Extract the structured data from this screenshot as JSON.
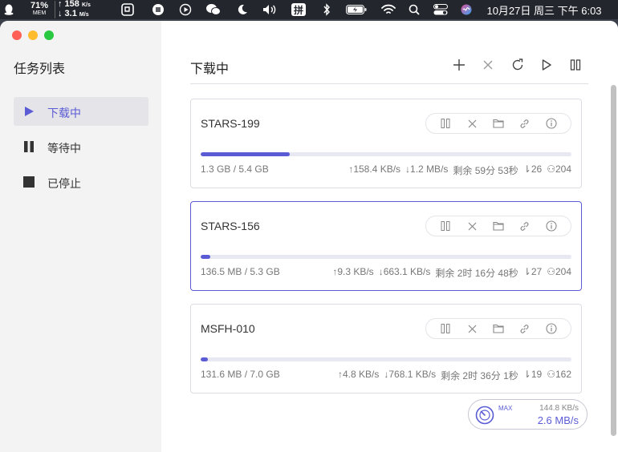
{
  "menubar": {
    "cpu_percent": "71%",
    "mem_label": "MEM",
    "net_up": "↑ 158",
    "net_up_unit": "K/s",
    "net_down": "↓ 3.1",
    "net_down_unit": "M/s",
    "input_method": "拼",
    "datetime": "10月27日 周三 下午 6:03"
  },
  "sidebar": {
    "title": "任务列表",
    "items": [
      {
        "label": "下载中",
        "icon": "play-icon"
      },
      {
        "label": "等待中",
        "icon": "pause-icon"
      },
      {
        "label": "已停止",
        "icon": "stop-icon"
      }
    ]
  },
  "main": {
    "title": "下载中",
    "toolbar_icons": [
      "plus-icon",
      "close-icon",
      "refresh-icon",
      "play-icon",
      "pause-icon"
    ]
  },
  "tasks": [
    {
      "name": "STARS-199",
      "progress": 0.24,
      "size": "1.3 GB / 5.4 GB",
      "upload": "158.4 KB/s",
      "download": "1.2 MB/s",
      "remaining": "剩余 59分 53秒",
      "connections": "26",
      "peers": "204"
    },
    {
      "name": "STARS-156",
      "progress": 0.026,
      "size": "136.5 MB / 5.3 GB",
      "upload": "9.3 KB/s",
      "download": "663.1 KB/s",
      "remaining": "剩余 2时 16分 48秒",
      "connections": "27",
      "peers": "204"
    },
    {
      "name": "MSFH-010",
      "progress": 0.019,
      "size": "131.6 MB / 7.0 GB",
      "upload": "4.8 KB/s",
      "download": "768.1 KB/s",
      "remaining": "剩余 2时 36分 1秒",
      "connections": "19",
      "peers": "162"
    }
  ],
  "speed_meter": {
    "max_label": "MAX",
    "upload": "144.8 KB/s",
    "download": "2.6 MB/s"
  },
  "colors": {
    "accent": "#5b5bd6",
    "sidebar_bg": "#f3f3f4",
    "menubar_bg": "#23262d"
  }
}
